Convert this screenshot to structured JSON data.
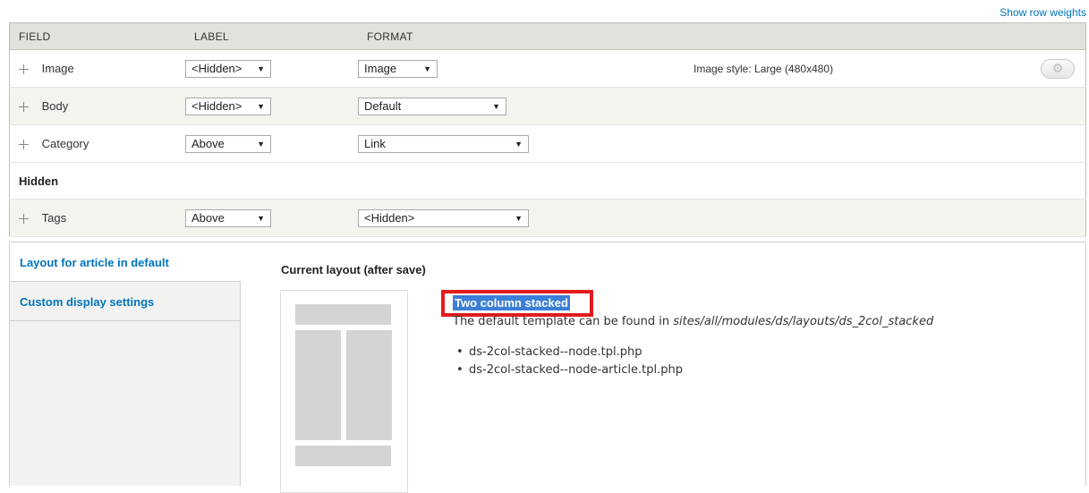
{
  "top_link": "Show row weights",
  "table": {
    "headers": [
      "FIELD",
      "LABEL",
      "FORMAT"
    ],
    "rows": [
      {
        "field": "Image",
        "label": "<Hidden>",
        "format": "Image",
        "summary": "Image style: Large (480x480)"
      },
      {
        "field": "Body",
        "label": "<Hidden>",
        "format": "Default"
      },
      {
        "field": "Category",
        "label": "Above",
        "format": "Link"
      }
    ],
    "region_hidden": "Hidden",
    "hidden_rows": [
      {
        "field": "Tags",
        "label": "Above",
        "format": "<Hidden>"
      }
    ]
  },
  "vtabs": {
    "items": [
      "Layout for article in default",
      "Custom display settings"
    ]
  },
  "layout": {
    "title": "Current layout (after save)",
    "name": "Two column stacked",
    "desc_prefix": "The default template can be found in ",
    "desc_path": "sites/all/modules/ds/layouts/ds_2col_stacked",
    "templates": [
      "ds-2col-stacked--node.tpl.php",
      "ds-2col-stacked--node-article.tpl.php"
    ]
  },
  "icons": {
    "drag": "drag-handle-icon",
    "gear": "gear-icon",
    "arrow": "dropdown-arrow-icon"
  }
}
